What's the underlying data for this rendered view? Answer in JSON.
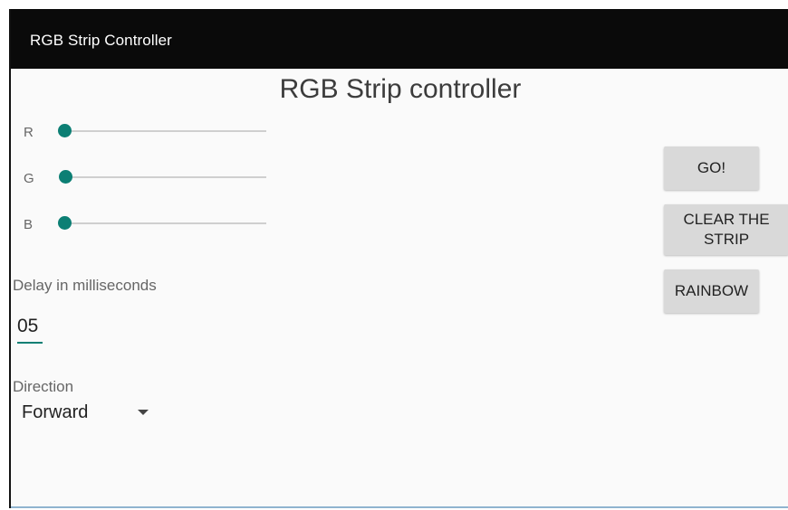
{
  "appbar": {
    "title": "RGB Strip Controller"
  },
  "main": {
    "heading": "RGB Strip controller",
    "sliders": [
      {
        "label": "R",
        "value": 0
      },
      {
        "label": "G",
        "value": 0
      },
      {
        "label": "B",
        "value": 0
      }
    ],
    "delay": {
      "label": "Delay in milliseconds",
      "value": "05"
    },
    "direction": {
      "label": "Direction",
      "selected": "Forward"
    }
  },
  "buttons": {
    "go": "GO!",
    "clear": "CLEAR THE STRIP",
    "rainbow": "RAINBOW"
  },
  "colors": {
    "accent": "#0c7f74",
    "appbar": "#0a0a0a",
    "button": "#d9d9d9"
  },
  "icons": {
    "dropdown": "dropdown-arrow-icon"
  }
}
